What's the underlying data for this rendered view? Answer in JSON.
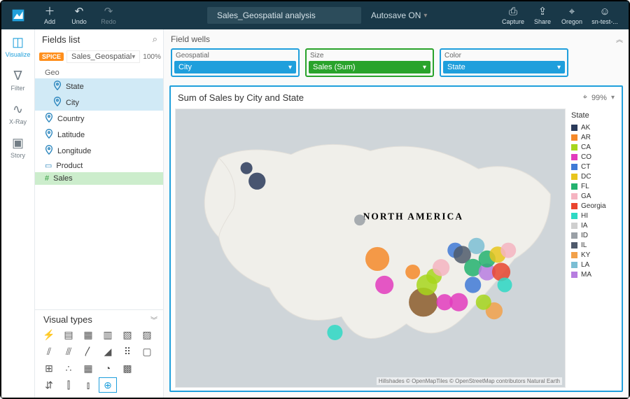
{
  "topbar": {
    "add": "Add",
    "undo": "Undo",
    "redo": "Redo",
    "title": "Sales_Geospatial analysis",
    "autosave": "Autosave ON",
    "capture": "Capture",
    "share": "Share",
    "region": "Oregon",
    "user": "sn-test-..."
  },
  "rail": {
    "visualize": "Visualize",
    "filter": "Filter",
    "xray": "X-Ray",
    "story": "Story"
  },
  "fields": {
    "header": "Fields list",
    "spice": "SPICE",
    "dataset": "Sales_Geospatial",
    "pct": "100%",
    "group_geo": "Geo",
    "state": "State",
    "city": "City",
    "country": "Country",
    "latitude": "Latitude",
    "longitude": "Longitude",
    "product": "Product",
    "sales": "Sales"
  },
  "visual_types_header": "Visual types",
  "wells": {
    "header": "Field wells",
    "geospatial_label": "Geospatial",
    "geospatial_value": "City",
    "size_label": "Size",
    "size_value": "Sales (Sum)",
    "color_label": "Color",
    "color_value": "State"
  },
  "viz": {
    "title": "Sum of Sales by City and State",
    "zoom": "99%",
    "map_label": "NORTH AMERICA",
    "attribution": "Hillshades © OpenMapTiles © OpenStreetMap contributors Natural Earth"
  },
  "legend": {
    "header": "State",
    "items": [
      {
        "label": "AK",
        "color": "#2a3a5a"
      },
      {
        "label": "AR",
        "color": "#f5892a"
      },
      {
        "label": "CA",
        "color": "#a7d61c"
      },
      {
        "label": "CO",
        "color": "#e23bbd"
      },
      {
        "label": "CT",
        "color": "#3f79d6"
      },
      {
        "label": "DC",
        "color": "#e8c51d"
      },
      {
        "label": "FL",
        "color": "#23b26f"
      },
      {
        "label": "GA",
        "color": "#f5b4c1"
      },
      {
        "label": "Georgia",
        "color": "#e8452f"
      },
      {
        "label": "HI",
        "color": "#2fd9c4"
      },
      {
        "label": "IA",
        "color": "#cfcfcf"
      },
      {
        "label": "ID",
        "color": "#9aa0a6"
      },
      {
        "label": "IL",
        "color": "#4f5a6b"
      },
      {
        "label": "KY",
        "color": "#f2a14a"
      },
      {
        "label": "LA",
        "color": "#7bbed4"
      },
      {
        "label": "MA",
        "color": "#b77de0"
      }
    ]
  },
  "chart_data": {
    "type": "scatter",
    "title": "Sum of Sales by City and State",
    "encoding": {
      "x": "longitude",
      "y": "latitude",
      "size": "sales_sum",
      "color": "state"
    },
    "xlabel": "",
    "ylabel": "",
    "points": [
      {
        "lon": -150,
        "lat": 61,
        "sales_sum": 12,
        "state": "AK",
        "color": "#2a3a5a"
      },
      {
        "lon": -147,
        "lat": 58,
        "sales_sum": 24,
        "state": "AK",
        "color": "#2a3a5a"
      },
      {
        "lon": -118,
        "lat": 49,
        "sales_sum": 10,
        "state": "ID",
        "color": "#9aa0a6"
      },
      {
        "lon": -113,
        "lat": 40,
        "sales_sum": 48,
        "state": "CO",
        "color": "#f5892a"
      },
      {
        "lon": -111,
        "lat": 34,
        "sales_sum": 28,
        "state": "CO",
        "color": "#e23bbd"
      },
      {
        "lon": -125,
        "lat": 23,
        "sales_sum": 20,
        "state": "HI",
        "color": "#2fd9c4"
      },
      {
        "lon": -100,
        "lat": 30,
        "sales_sum": 70,
        "state": "LA",
        "color": "#8a5a2a"
      },
      {
        "lon": -99,
        "lat": 34,
        "sales_sum": 36,
        "state": "CA",
        "color": "#a7d61c"
      },
      {
        "lon": -97,
        "lat": 36,
        "sales_sum": 20,
        "state": "CA",
        "color": "#a7d61c"
      },
      {
        "lon": -103,
        "lat": 37,
        "sales_sum": 18,
        "state": "AR",
        "color": "#f5892a"
      },
      {
        "lon": -94,
        "lat": 30,
        "sales_sum": 22,
        "state": "CO",
        "color": "#e23bbd"
      },
      {
        "lon": -95,
        "lat": 38,
        "sales_sum": 24,
        "state": "GA",
        "color": "#f5b4c1"
      },
      {
        "lon": -91,
        "lat": 42,
        "sales_sum": 20,
        "state": "CT",
        "color": "#3f79d6"
      },
      {
        "lon": -89,
        "lat": 41,
        "sales_sum": 26,
        "state": "IL",
        "color": "#4f5a6b"
      },
      {
        "lon": -90,
        "lat": 30,
        "sales_sum": 28,
        "state": "CO",
        "color": "#e23bbd"
      },
      {
        "lon": -86,
        "lat": 34,
        "sales_sum": 22,
        "state": "CT",
        "color": "#3f79d6"
      },
      {
        "lon": -86,
        "lat": 38,
        "sales_sum": 26,
        "state": "FL",
        "color": "#23b26f"
      },
      {
        "lon": -85,
        "lat": 43,
        "sales_sum": 22,
        "state": "IA",
        "color": "#7bbed4"
      },
      {
        "lon": -82,
        "lat": 37,
        "sales_sum": 24,
        "state": "MA",
        "color": "#b77de0"
      },
      {
        "lon": -82,
        "lat": 40,
        "sales_sum": 24,
        "state": "FL",
        "color": "#23b26f"
      },
      {
        "lon": -79,
        "lat": 41,
        "sales_sum": 22,
        "state": "DC",
        "color": "#e8c51d"
      },
      {
        "lon": -78,
        "lat": 37,
        "sales_sum": 28,
        "state": "Georgia",
        "color": "#e8452f"
      },
      {
        "lon": -80,
        "lat": 28,
        "sales_sum": 24,
        "state": "KY",
        "color": "#f2a14a"
      },
      {
        "lon": -77,
        "lat": 34,
        "sales_sum": 18,
        "state": "HI",
        "color": "#2fd9c4"
      },
      {
        "lon": -76,
        "lat": 42,
        "sales_sum": 20,
        "state": "GA",
        "color": "#f5b4c1"
      },
      {
        "lon": -83,
        "lat": 30,
        "sales_sum": 20,
        "state": "CA",
        "color": "#a7d61c"
      }
    ]
  }
}
